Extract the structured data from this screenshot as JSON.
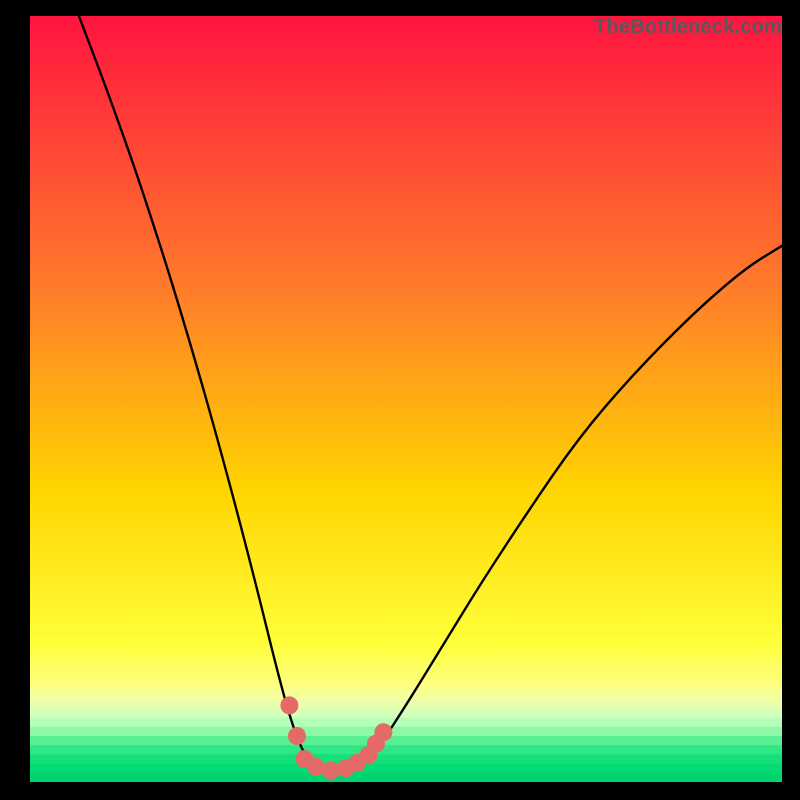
{
  "watermark": "TheBottleneck.com",
  "colors": {
    "background_black": "#000000",
    "curve": "#000000",
    "dots": "#e46a68",
    "gradient_top": "#ff1440",
    "gradient_mid1": "#ff7a2b",
    "gradient_mid2": "#ffd500",
    "gradient_bottom_yellow": "#ffff3a",
    "gradient_pale": "#f9ffbf",
    "gradient_green": "#00e277"
  },
  "chart_data": {
    "type": "line",
    "title": "",
    "xlabel": "",
    "ylabel": "",
    "xlim": [
      0,
      100
    ],
    "ylim": [
      0,
      100
    ],
    "note": "Axes implied only; values are relative percentages read from curve geometry. Minimum (bottleneck sweet spot) around x≈40.",
    "curve_points": [
      {
        "x": 6.5,
        "y": 100
      },
      {
        "x": 10,
        "y": 91
      },
      {
        "x": 14,
        "y": 80
      },
      {
        "x": 18,
        "y": 68
      },
      {
        "x": 22,
        "y": 55
      },
      {
        "x": 26,
        "y": 41
      },
      {
        "x": 30,
        "y": 26
      },
      {
        "x": 33,
        "y": 14
      },
      {
        "x": 35,
        "y": 7
      },
      {
        "x": 37,
        "y": 2.5
      },
      {
        "x": 40,
        "y": 1.5
      },
      {
        "x": 43,
        "y": 2
      },
      {
        "x": 46,
        "y": 4
      },
      {
        "x": 50,
        "y": 10
      },
      {
        "x": 55,
        "y": 18
      },
      {
        "x": 60,
        "y": 26
      },
      {
        "x": 66,
        "y": 35
      },
      {
        "x": 73,
        "y": 45
      },
      {
        "x": 80,
        "y": 53
      },
      {
        "x": 88,
        "y": 61
      },
      {
        "x": 95,
        "y": 67
      },
      {
        "x": 100,
        "y": 70
      }
    ],
    "dot_points": [
      {
        "x": 34.5,
        "y": 10
      },
      {
        "x": 35.5,
        "y": 6
      },
      {
        "x": 36.5,
        "y": 3
      },
      {
        "x": 38,
        "y": 2
      },
      {
        "x": 40,
        "y": 1.5
      },
      {
        "x": 42,
        "y": 1.8
      },
      {
        "x": 43.5,
        "y": 2.5
      },
      {
        "x": 45,
        "y": 3.5
      },
      {
        "x": 46,
        "y": 5
      },
      {
        "x": 47,
        "y": 6.5
      }
    ]
  }
}
